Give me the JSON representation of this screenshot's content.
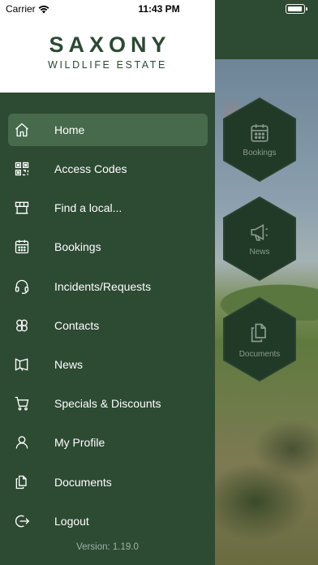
{
  "status_bar": {
    "carrier": "Carrier",
    "time": "11:43 PM"
  },
  "drawer": {
    "logo_title": "SAXONY",
    "logo_subtitle": "WILDLIFE ESTATE",
    "menu": [
      {
        "label": "Home",
        "icon": "home-icon",
        "active": true
      },
      {
        "label": "Access Codes",
        "icon": "qr-code-icon",
        "active": false
      },
      {
        "label": "Find a local...",
        "icon": "storefront-icon",
        "active": false
      },
      {
        "label": "Bookings",
        "icon": "calendar-icon",
        "active": false
      },
      {
        "label": "Incidents/Requests",
        "icon": "headset-icon",
        "active": false
      },
      {
        "label": "Contacts",
        "icon": "contacts-icon",
        "active": false
      },
      {
        "label": "News",
        "icon": "megaphone-icon",
        "active": false
      },
      {
        "label": "Specials & Discounts",
        "icon": "cart-icon",
        "active": false
      },
      {
        "label": "My Profile",
        "icon": "user-icon",
        "active": false
      },
      {
        "label": "Documents",
        "icon": "documents-icon",
        "active": false
      },
      {
        "label": "Logout",
        "icon": "logout-icon",
        "active": false
      }
    ],
    "version": "Version: 1.19.0"
  },
  "background_tiles": [
    {
      "label": "Bookings",
      "icon": "calendar-icon"
    },
    {
      "label": "News",
      "icon": "megaphone-icon"
    },
    {
      "label": "Documents",
      "icon": "documents-icon"
    }
  ],
  "colors": {
    "drawer_bg": "#2d4a33",
    "active_item_bg": "#476a4d",
    "logo_green": "#2a4a32"
  }
}
